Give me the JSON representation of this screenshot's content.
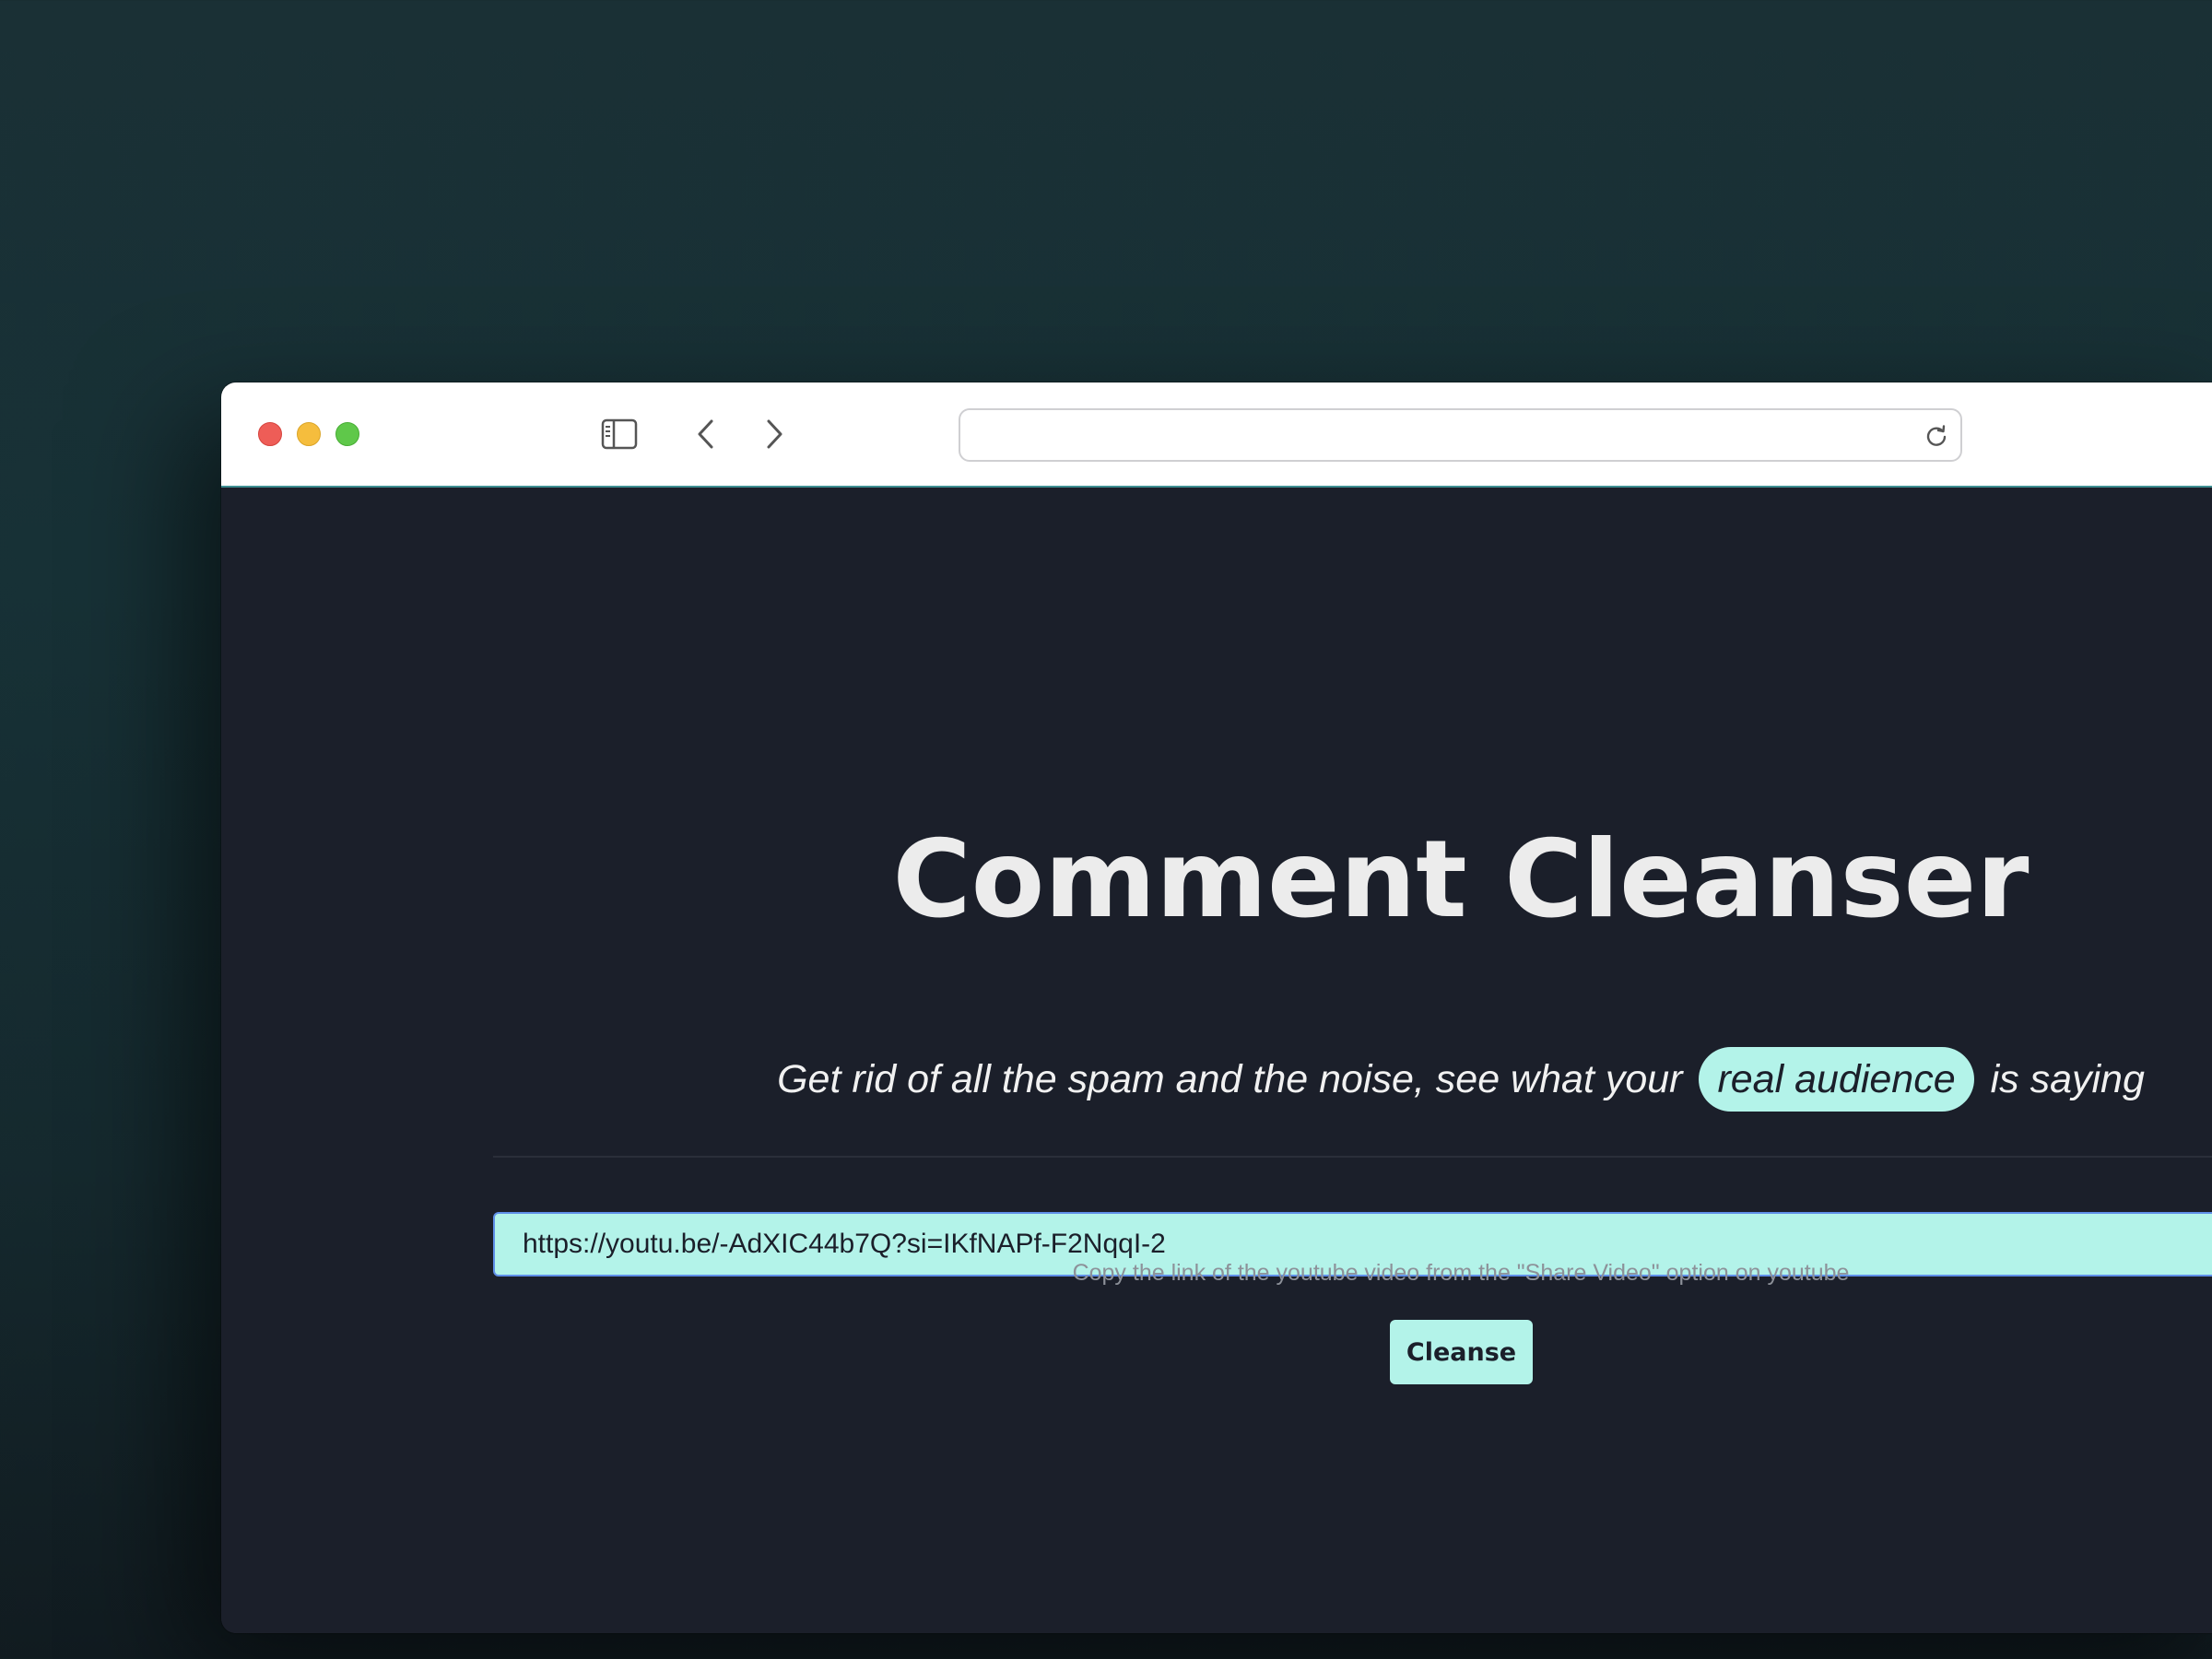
{
  "browser": {
    "address_bar": {
      "value": "",
      "icon": "reload-icon"
    },
    "toolbar_icons": [
      "sidebar-icon",
      "back-chevron-icon",
      "forward-chevron-icon"
    ],
    "traffic_lights": [
      "close",
      "minimize",
      "zoom"
    ]
  },
  "page": {
    "title": "Comment Cleanser",
    "subtitle_before": "Get rid of all the spam and the noise, see what your",
    "subtitle_highlight": "real audience",
    "subtitle_after": "is saying",
    "url_input": {
      "value": "https://youtu.be/-AdXIC44b7Q?si=IKfNAPf-F2NqqI-2"
    },
    "hint": "Copy the link of the youtube video from the \"Share Video\" option on youtube",
    "submit_label": "Cleanse"
  },
  "colors": {
    "accent": "#b3f3e9",
    "background": "#1b1f2a",
    "desktop": "#173136",
    "input_focus_border": "#5f8fe8"
  }
}
